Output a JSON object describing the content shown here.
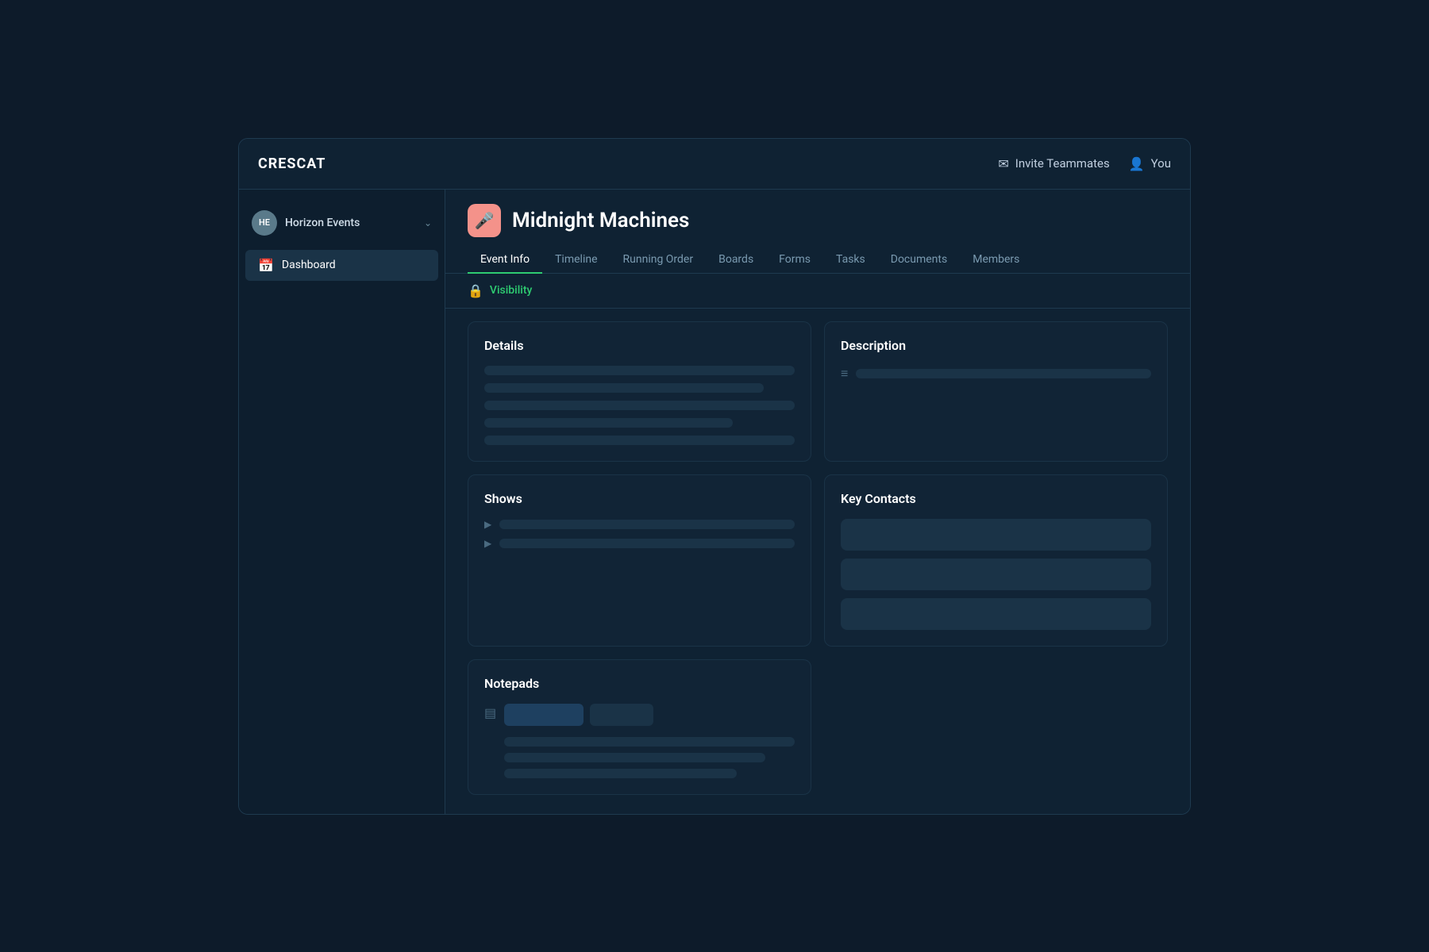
{
  "brand": "CRESCAT",
  "header": {
    "invite_label": "Invite Teammates",
    "user_label": "You"
  },
  "sidebar": {
    "org": {
      "initials": "HE",
      "name": "Horizon Events"
    },
    "items": [
      {
        "id": "dashboard",
        "label": "Dashboard",
        "icon": "📅"
      }
    ]
  },
  "event": {
    "icon": "🎤",
    "title": "Midnight Machines",
    "tabs": [
      {
        "id": "event-info",
        "label": "Event Info",
        "active": true
      },
      {
        "id": "timeline",
        "label": "Timeline",
        "active": false
      },
      {
        "id": "running-order",
        "label": "Running Order",
        "active": false
      },
      {
        "id": "boards",
        "label": "Boards",
        "active": false
      },
      {
        "id": "forms",
        "label": "Forms",
        "active": false
      },
      {
        "id": "tasks",
        "label": "Tasks",
        "active": false
      },
      {
        "id": "documents",
        "label": "Documents",
        "active": false
      },
      {
        "id": "members",
        "label": "Members",
        "active": false
      }
    ],
    "visibility_label": "Visibility"
  },
  "cards": {
    "details": {
      "title": "Details"
    },
    "description": {
      "title": "Description"
    },
    "shows": {
      "title": "Shows"
    },
    "key_contacts": {
      "title": "Key Contacts"
    },
    "notepads": {
      "title": "Notepads"
    }
  },
  "icons": {
    "mail": "✉",
    "user": "👤",
    "chevron_down": "⌄",
    "calendar": "📅",
    "lock": "🔒",
    "menu": "≡",
    "play": "▶",
    "notepad": "▤",
    "microphone": "🎤"
  }
}
